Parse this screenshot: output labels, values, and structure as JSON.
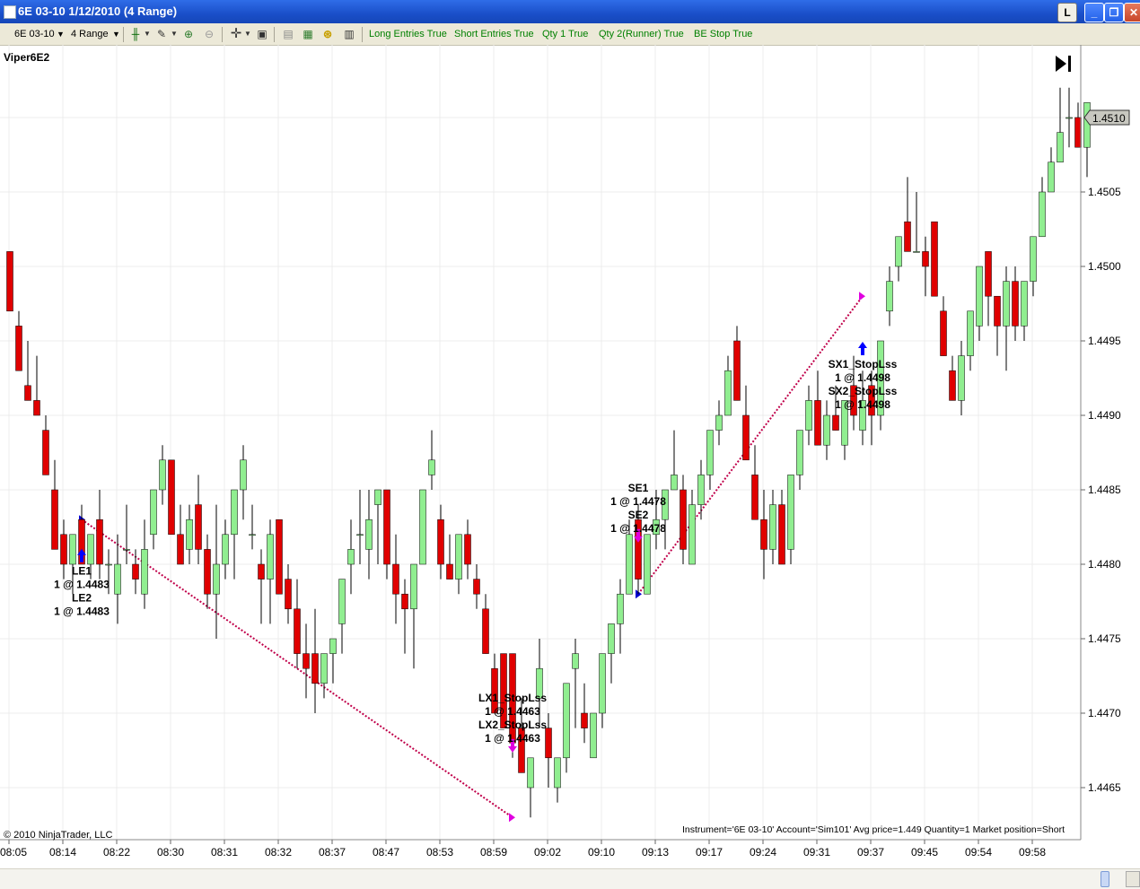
{
  "window": {
    "title": "6E 03-10  1/12/2010 (4 Range)",
    "buttons": [
      "L",
      "_",
      "❐",
      "✕"
    ]
  },
  "toolbar": {
    "instrument": "6E 03-10",
    "period": "4 Range",
    "strategy_params": [
      "Long Entries True",
      "Short Entries True",
      "Qty 1 True",
      "Qty 2(Runner) True",
      "BE Stop True"
    ],
    "icons": [
      "candlestick-icon",
      "pencil-icon",
      "zoom-in-icon",
      "zoom-out-icon",
      "crosshair-icon",
      "properties-icon",
      "chart-trader-icon",
      "indicators-icon",
      "strategies-icon",
      "data-box-icon"
    ]
  },
  "chart": {
    "strategy_label": "Viper6E2",
    "copyright": "© 2010 NinjaTrader, LLC",
    "status_line": "Instrument='6E 03-10' Account='Sim101' Avg price=1.449 Quantity=1 Market position=Short",
    "last_price": "1.4510",
    "price_ticks": [
      "1.4505",
      "1.4500",
      "1.4495",
      "1.4490",
      "1.4485",
      "1.4480",
      "1.4475",
      "1.4470",
      "1.4465"
    ],
    "time_ticks": [
      "08:05",
      "08:14",
      "08:22",
      "08:30",
      "08:31",
      "08:32",
      "08:37",
      "08:47",
      "08:53",
      "08:59",
      "09:02",
      "09:10",
      "09:13",
      "09:17",
      "09:24",
      "09:31",
      "09:37",
      "09:45",
      "09:54",
      "09:58"
    ],
    "colors": {
      "up": "#90ee90",
      "down": "#e00000",
      "wick": "#000000",
      "trade_line": "#c0004a",
      "entry_arrow": "#0000ff",
      "exit_arrow": "#e000e0"
    },
    "candles": [
      [
        1.4501,
        1.4501,
        1.4497,
        1.4497
      ],
      [
        1.4496,
        1.4497,
        1.4493,
        1.4493
      ],
      [
        1.4492,
        1.4495,
        1.4491,
        1.4491
      ],
      [
        1.4491,
        1.4494,
        1.449,
        1.449
      ],
      [
        1.4489,
        1.449,
        1.4486,
        1.4486
      ],
      [
        1.4485,
        1.4487,
        1.4481,
        1.4481
      ],
      [
        1.4482,
        1.4483,
        1.4479,
        1.448
      ],
      [
        1.448,
        1.4482,
        1.4478,
        1.4482
      ],
      [
        1.4483,
        1.4484,
        1.448,
        1.448
      ],
      [
        1.448,
        1.4482,
        1.4479,
        1.4482
      ],
      [
        1.4483,
        1.4485,
        1.4479,
        1.448
      ],
      [
        1.448,
        1.4481,
        1.4478,
        1.448
      ],
      [
        1.4478,
        1.4482,
        1.4476,
        1.448
      ],
      [
        1.4481,
        1.4484,
        1.448,
        1.4481
      ],
      [
        1.448,
        1.4481,
        1.4478,
        1.4479
      ],
      [
        1.4478,
        1.4483,
        1.4477,
        1.4481
      ],
      [
        1.4482,
        1.4485,
        1.4481,
        1.4485
      ],
      [
        1.4485,
        1.4488,
        1.4484,
        1.4487
      ],
      [
        1.4487,
        1.4487,
        1.4482,
        1.4482
      ],
      [
        1.4482,
        1.4484,
        1.448,
        1.448
      ],
      [
        1.4481,
        1.4484,
        1.448,
        1.4483
      ],
      [
        1.4484,
        1.4486,
        1.448,
        1.4481
      ],
      [
        1.4481,
        1.4482,
        1.4477,
        1.4478
      ],
      [
        1.4478,
        1.4484,
        1.4475,
        1.448
      ],
      [
        1.448,
        1.4483,
        1.4479,
        1.4482
      ],
      [
        1.4482,
        1.4484,
        1.4479,
        1.4485
      ],
      [
        1.4485,
        1.4488,
        1.4483,
        1.4487
      ],
      [
        1.4482,
        1.4484,
        1.4481,
        1.4482
      ],
      [
        1.448,
        1.4481,
        1.4476,
        1.4479
      ],
      [
        1.4479,
        1.4483,
        1.4476,
        1.4482
      ],
      [
        1.4483,
        1.4483,
        1.4478,
        1.4478
      ],
      [
        1.4479,
        1.448,
        1.4476,
        1.4477
      ],
      [
        1.4477,
        1.4479,
        1.4473,
        1.4474
      ],
      [
        1.4474,
        1.4476,
        1.4471,
        1.4473
      ],
      [
        1.4474,
        1.4477,
        1.447,
        1.4472
      ],
      [
        1.4472,
        1.4473,
        1.4471,
        1.4474
      ],
      [
        1.4474,
        1.4475,
        1.4472,
        1.4475
      ],
      [
        1.4476,
        1.4479,
        1.4474,
        1.4479
      ],
      [
        1.448,
        1.4483,
        1.4478,
        1.4481
      ],
      [
        1.4482,
        1.4485,
        1.448,
        1.4482
      ],
      [
        1.4481,
        1.4485,
        1.4479,
        1.4483
      ],
      [
        1.4484,
        1.4485,
        1.448,
        1.4485
      ],
      [
        1.4485,
        1.4485,
        1.4479,
        1.448
      ],
      [
        1.448,
        1.4482,
        1.4476,
        1.4478
      ],
      [
        1.4478,
        1.4479,
        1.4474,
        1.4477
      ],
      [
        1.4477,
        1.448,
        1.4473,
        1.448
      ],
      [
        1.448,
        1.4485,
        1.448,
        1.4485
      ],
      [
        1.4486,
        1.4489,
        1.4485,
        1.4487
      ],
      [
        1.4483,
        1.4484,
        1.4479,
        1.448
      ],
      [
        1.448,
        1.4482,
        1.4479,
        1.4479
      ],
      [
        1.4479,
        1.4481,
        1.4478,
        1.4482
      ],
      [
        1.4482,
        1.4483,
        1.4479,
        1.448
      ],
      [
        1.4479,
        1.448,
        1.4477,
        1.4478
      ],
      [
        1.4477,
        1.4478,
        1.4474,
        1.4474
      ],
      [
        1.4473,
        1.4474,
        1.447,
        1.447
      ],
      [
        1.4474,
        1.4474,
        1.447,
        1.4469
      ],
      [
        1.4474,
        1.4474,
        1.4467,
        1.4468
      ],
      [
        1.4469,
        1.4471,
        1.4466,
        1.4466
      ],
      [
        1.4465,
        1.4467,
        1.4463,
        1.4467
      ],
      [
        1.4471,
        1.4475,
        1.4469,
        1.4473
      ],
      [
        1.4469,
        1.447,
        1.4465,
        1.4467
      ],
      [
        1.4465,
        1.4467,
        1.4464,
        1.4467
      ],
      [
        1.4467,
        1.4472,
        1.4466,
        1.4472
      ],
      [
        1.4473,
        1.4475,
        1.4469,
        1.4474
      ],
      [
        1.447,
        1.4472,
        1.4468,
        1.4469
      ],
      [
        1.4467,
        1.447,
        1.4467,
        1.447
      ],
      [
        1.447,
        1.4474,
        1.4469,
        1.4474
      ],
      [
        1.4474,
        1.4476,
        1.4472,
        1.4476
      ],
      [
        1.4476,
        1.4479,
        1.4474,
        1.4478
      ],
      [
        1.4478,
        1.4483,
        1.4478,
        1.4482
      ],
      [
        1.4483,
        1.4484,
        1.4478,
        1.4479
      ],
      [
        1.4478,
        1.4482,
        1.4478,
        1.4482
      ],
      [
        1.4482,
        1.4485,
        1.4481,
        1.4483
      ],
      [
        1.4483,
        1.4485,
        1.4481,
        1.4485
      ],
      [
        1.4485,
        1.4489,
        1.4486,
        1.4486
      ],
      [
        1.4485,
        1.4486,
        1.448,
        1.4481
      ],
      [
        1.448,
        1.4485,
        1.448,
        1.4484
      ],
      [
        1.4484,
        1.4487,
        1.4483,
        1.4486
      ],
      [
        1.4486,
        1.4489,
        1.4485,
        1.4489
      ],
      [
        1.4489,
        1.4491,
        1.4488,
        1.449
      ],
      [
        1.449,
        1.4494,
        1.449,
        1.4493
      ],
      [
        1.4495,
        1.4496,
        1.4491,
        1.4491
      ],
      [
        1.449,
        1.4492,
        1.4487,
        1.4487
      ],
      [
        1.4486,
        1.4488,
        1.4484,
        1.4483
      ],
      [
        1.4483,
        1.4485,
        1.4479,
        1.4481
      ],
      [
        1.4481,
        1.4485,
        1.448,
        1.4484
      ],
      [
        1.4484,
        1.4485,
        1.448,
        1.448
      ],
      [
        1.4481,
        1.4486,
        1.448,
        1.4486
      ],
      [
        1.4486,
        1.4489,
        1.4485,
        1.4489
      ],
      [
        1.4489,
        1.4492,
        1.4488,
        1.4491
      ],
      [
        1.4491,
        1.4493,
        1.4488,
        1.4488
      ],
      [
        1.4488,
        1.4491,
        1.4487,
        1.449
      ],
      [
        1.449,
        1.4492,
        1.4489,
        1.4489
      ],
      [
        1.4488,
        1.449,
        1.4487,
        1.4491
      ],
      [
        1.4492,
        1.4494,
        1.4489,
        1.449
      ],
      [
        1.4489,
        1.4493,
        1.4488,
        1.4491
      ],
      [
        1.4492,
        1.4493,
        1.4488,
        1.449
      ],
      [
        1.449,
        1.4494,
        1.4489,
        1.4495
      ],
      [
        1.4497,
        1.45,
        1.4496,
        1.4499
      ],
      [
        1.45,
        1.4502,
        1.4499,
        1.4502
      ],
      [
        1.4503,
        1.4506,
        1.4501,
        1.4501
      ],
      [
        1.4501,
        1.4505,
        1.4501,
        1.4501
      ],
      [
        1.4501,
        1.4502,
        1.4498,
        1.45
      ],
      [
        1.4503,
        1.4503,
        1.4498,
        1.4498
      ],
      [
        1.4497,
        1.4498,
        1.4494,
        1.4494
      ],
      [
        1.4493,
        1.4494,
        1.4491,
        1.4491
      ],
      [
        1.4491,
        1.4495,
        1.449,
        1.4494
      ],
      [
        1.4494,
        1.4497,
        1.4493,
        1.4497
      ],
      [
        1.4496,
        1.4499,
        1.4495,
        1.45
      ],
      [
        1.4501,
        1.4501,
        1.4496,
        1.4498
      ],
      [
        1.4498,
        1.4497,
        1.4494,
        1.4496
      ],
      [
        1.4496,
        1.45,
        1.4493,
        1.4499
      ],
      [
        1.4499,
        1.45,
        1.4495,
        1.4496
      ],
      [
        1.4496,
        1.4499,
        1.4495,
        1.4499
      ],
      [
        1.4499,
        1.4502,
        1.4498,
        1.4502
      ],
      [
        1.4502,
        1.4506,
        1.4503,
        1.4505
      ],
      [
        1.4505,
        1.4508,
        1.4506,
        1.4507
      ],
      [
        1.4507,
        1.4512,
        1.4509,
        1.4509
      ],
      [
        1.451,
        1.4512,
        1.4508,
        1.451
      ],
      [
        1.451,
        1.4511,
        1.4508,
        1.4508
      ],
      [
        1.4508,
        1.4511,
        1.4506,
        1.4511
      ]
    ],
    "trades": [
      {
        "from_bar": 8,
        "from_price": 1.4483,
        "to_bar": 56,
        "to_price": 1.4463
      },
      {
        "from_bar": 70,
        "from_price": 1.4478,
        "to_bar": 95,
        "to_price": 1.4498
      }
    ],
    "signals": [
      {
        "bar": 8,
        "price": 1.44805,
        "type": "entry-up",
        "lines": [
          "LE1",
          "1 @ 1.4483",
          "LE2",
          "1 @ 1.4483"
        ]
      },
      {
        "bar": 56,
        "price": 1.44679,
        "type": "exit-down",
        "lines": [
          "LX1_StopLss",
          "1 @ 1.4463",
          "LX2_StopLss",
          "1 @ 1.4463"
        ]
      },
      {
        "bar": 70,
        "price": 1.4482,
        "type": "exit-down",
        "lines": [
          "SE1",
          "1 @ 1.4478",
          "SE2",
          "1 @ 1.4478"
        ]
      },
      {
        "bar": 95,
        "price": 1.44944,
        "type": "entry-up",
        "lines": [
          "SX1_StopLss",
          "1 @ 1.4498",
          "SX2_StopLss",
          "1 @ 1.4498"
        ]
      }
    ]
  }
}
